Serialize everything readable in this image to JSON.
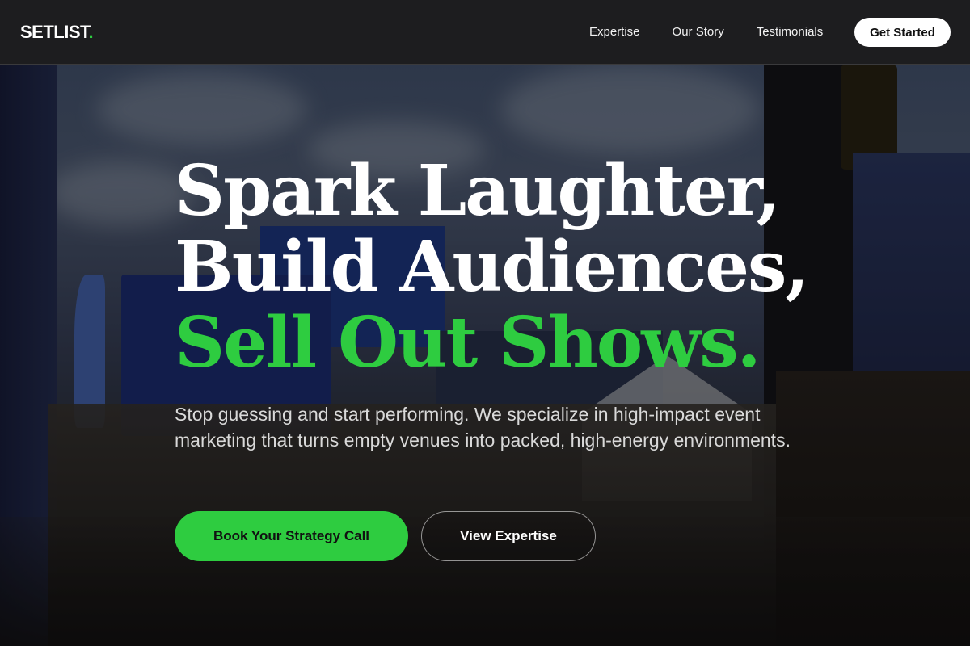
{
  "brand": {
    "name": "SETLIST",
    "dot": ".",
    "accent_color": "#2ecc40"
  },
  "nav": {
    "links": [
      "Expertise",
      "Our Story",
      "Testimonials"
    ],
    "cta": "Get Started"
  },
  "hero": {
    "headline_line1": "Spark Laughter,",
    "headline_line2": "Build Audiences,",
    "headline_line3": "Sell Out Shows.",
    "subtext": "Stop guessing and start performing. We specialize in high-impact event marketing that turns empty venues into packed, high-energy environments.",
    "primary_cta": "Book Your Strategy Call",
    "secondary_cta": "View Expertise"
  },
  "colors": {
    "nav_background": "#1d1d1f",
    "accent": "#2ecc40",
    "headline": "#ffffff"
  }
}
